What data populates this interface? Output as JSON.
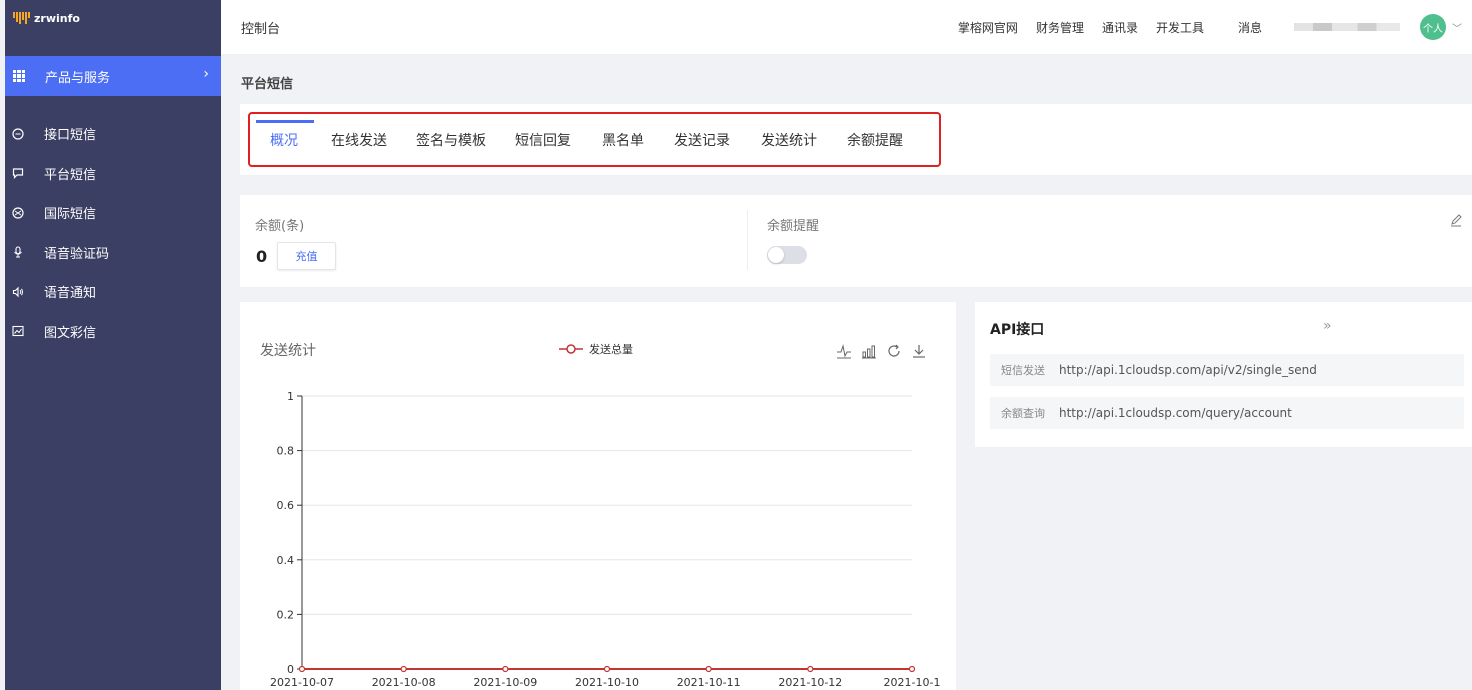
{
  "sidebar": {
    "brand": "zrwinfo",
    "group_label": "产品与服务",
    "items": [
      {
        "label": "接口短信",
        "icon": "chat-bubble-icon"
      },
      {
        "label": "平台短信",
        "icon": "message-square-icon"
      },
      {
        "label": "国际短信",
        "icon": "globe-icon"
      },
      {
        "label": "语音验证码",
        "icon": "microphone-icon"
      },
      {
        "label": "语音通知",
        "icon": "speaker-icon"
      },
      {
        "label": "图文彩信",
        "icon": "image-chart-icon"
      }
    ]
  },
  "header": {
    "title": "控制台",
    "links": [
      "掌榕网官网",
      "财务管理",
      "通讯录",
      "开发工具"
    ],
    "messages": "消息",
    "avatar_text": "个人"
  },
  "page": {
    "heading": "平台短信"
  },
  "tabs": [
    {
      "label": "概况",
      "active": true
    },
    {
      "label": "在线发送"
    },
    {
      "label": "签名与模板"
    },
    {
      "label": "短信回复"
    },
    {
      "label": "黑名单"
    },
    {
      "label": "发送记录"
    },
    {
      "label": "发送统计"
    },
    {
      "label": "余额提醒"
    }
  ],
  "balance": {
    "label": "余额(条)",
    "value": "0",
    "recharge_label": "充值",
    "remind_label": "余额提醒",
    "remind_enabled": false
  },
  "colors": {
    "accent": "#4b6ef5",
    "sidebar_bg": "#3a3f63",
    "series_line": "#c23531",
    "highlight_border": "#e02020"
  },
  "chart_data": {
    "type": "line",
    "title": "发送统计",
    "categories": [
      "2021-10-07",
      "2021-10-08",
      "2021-10-09",
      "2021-10-10",
      "2021-10-11",
      "2021-10-12",
      "2021-10-1"
    ],
    "series": [
      {
        "name": "发送总量",
        "values": [
          0,
          0,
          0,
          0,
          0,
          0,
          0
        ]
      }
    ],
    "ylim": [
      0,
      1
    ],
    "yticks": [
      "0",
      "0.2",
      "0.4",
      "0.6",
      "0.8",
      "1"
    ],
    "grid": true,
    "legend": "top-center"
  },
  "api": {
    "title": "API接口",
    "rows": [
      {
        "key": "短信发送",
        "url": "http://api.1cloudsp.com/api/v2/single_send"
      },
      {
        "key": "余额查询",
        "url": "http://api.1cloudsp.com/query/account"
      }
    ]
  }
}
